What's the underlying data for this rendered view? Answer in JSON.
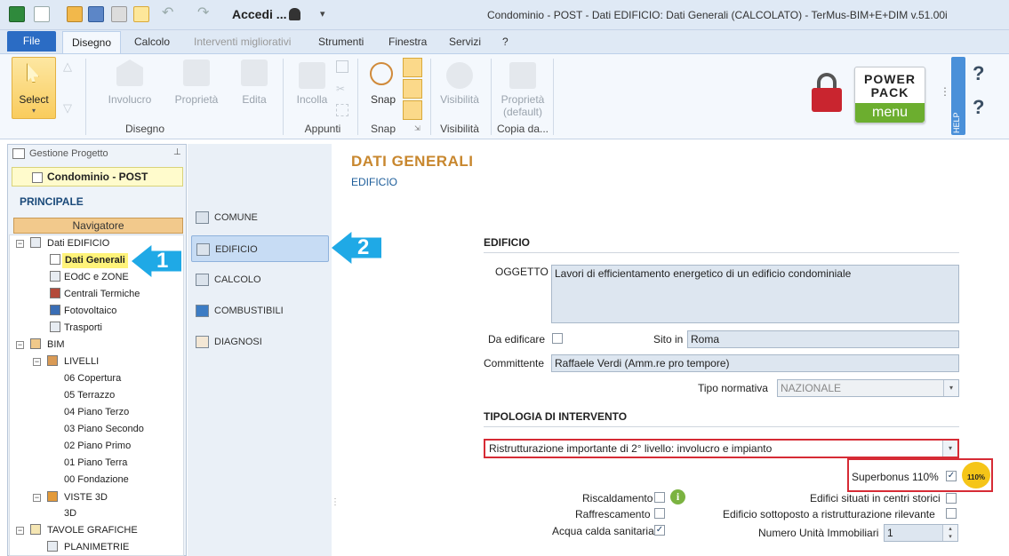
{
  "titlebar": {
    "window_title": "Condominio - POST -  Dati EDIFICIO: Dati Generali (CALCOLATO) - TerMus-BIM+E+DIM v.51.00i",
    "login_label": "Accedi ..."
  },
  "menu": {
    "tabs": [
      "File",
      "Disegno",
      "Calcolo",
      "Interventi migliorativi",
      "Strumenti",
      "Finestra",
      "Servizi",
      "?"
    ]
  },
  "ribbon": {
    "select_label": "Select",
    "involucro_label": "Involucro",
    "proprieta_label": "Proprietà",
    "edita_label": "Edita",
    "incolla_label": "Incolla",
    "snap_label": "Snap",
    "visibilita_label": "Visibilità",
    "proprieta_default_label": "Proprietà\n(default)",
    "groups": {
      "disegno": "Disegno",
      "appunti": "Appunti",
      "snap": "Snap",
      "visibilita": "Visibilità",
      "copia": "Copia da..."
    },
    "powerpack": {
      "line1": "POWER",
      "line2": "PACK",
      "line3": "menu"
    },
    "help_label": "HELP"
  },
  "left_panel": {
    "header": "Gestione Progetto",
    "project": "Condominio - POST",
    "section": "PRINCIPALE",
    "navigatore": "Navigatore",
    "tree": [
      "Dati EDIFICIO",
      "Dati Generali",
      "EOdC e ZONE",
      "Centrali Termiche",
      "Fotovoltaico",
      "Trasporti",
      "BIM",
      "LIVELLI",
      "06 Copertura",
      "05 Terrazzo",
      "04 Piano Terzo",
      "03 Piano Secondo",
      "02 Piano Primo",
      "01 Piano Terra",
      "00 Fondazione",
      "VISTE 3D",
      "3D",
      "TAVOLE GRAFICHE",
      "PLANIMETRIE"
    ]
  },
  "nav": {
    "items": [
      "COMUNE",
      "EDIFICIO",
      "CALCOLO",
      "COMBUSTIBILI",
      "DIAGNOSI"
    ],
    "selected": "EDIFICIO"
  },
  "callouts": {
    "one": "1",
    "two": "2"
  },
  "content": {
    "title": "DATI GENERALI",
    "subtitle": "EDIFICIO",
    "edificio_section": "EDIFICIO",
    "oggetto_label": "OGGETTO",
    "oggetto_value": "Lavori di efficientamento energetico di un edificio condominiale",
    "da_edificare_label": "Da edificare",
    "sito_label": "Sito in",
    "sito_value": "Roma",
    "committente_label": "Committente",
    "committente_value": "Raffaele Verdi (Amm.re pro tempore)",
    "tipo_normativa_label": "Tipo normativa",
    "tipo_normativa_value": "NAZIONALE",
    "tipologia_section": "TIPOLOGIA DI INTERVENTO",
    "tipologia_value": "Ristrutturazione importante di 2° livello: involucro e impianto",
    "superbonus_label": "Superbonus 110%",
    "superbonus_checked": "✓",
    "badge": "110%",
    "riscaldamento_label": "Riscaldamento",
    "raffrescamento_label": "Raffrescamento",
    "acs_label": "Acqua calda sanitaria",
    "acs_checked": "✓",
    "centri_storici_label": "Edifici situati in centri storici",
    "ristrutturazione_label": "Edificio sottoposto a ristrutturazione rilevante",
    "unita_label": "Numero Unità Immobiliari",
    "unita_value": "1"
  }
}
